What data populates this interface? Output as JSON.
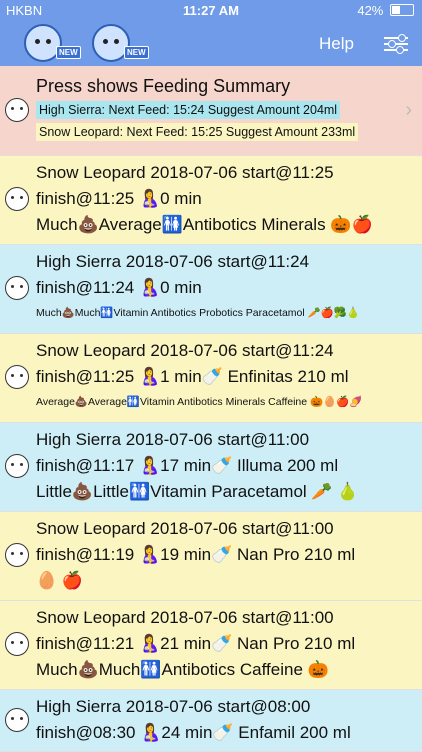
{
  "status": {
    "carrier": "HKBN",
    "time": "11:27 AM",
    "battery": "42%"
  },
  "nav": {
    "help_label": "Help",
    "new_badge": "NEW"
  },
  "summary": {
    "title": "Press shows Feeding Summary",
    "line1": "High Sierra:  Next Feed: 15:24 Suggest Amount 204ml",
    "line2": "Snow Leopard:  Next Feed: 15:25 Suggest Amount 233ml"
  },
  "rows": [
    {
      "color": "yellow",
      "l1": "Snow Leopard 2018-07-06 start@11:25",
      "l2": "finish@11:25 🤱0 min",
      "l3": "Much💩Average🚻Antibotics Minerals  🎃🍎",
      "l3_size": "large"
    },
    {
      "color": "blue",
      "l1": "High Sierra 2018-07-06 start@11:24",
      "l2": "finish@11:24  🤱0 min",
      "l3": "Much💩Much🚻Vitamin Antibotics Probotics Paracetamol  🥕🍎🥦🍐",
      "l3_size": "small"
    },
    {
      "color": "yellow",
      "l1": "Snow Leopard 2018-07-06 start@11:24",
      "l2": "finish@11:25  🤱1 min🍼 Enfinitas 210 ml",
      "l3": "Average💩Average🚻Vitamin Antibotics Minerals Caffeine  🎃🥚🍎🍠",
      "l3_size": "small"
    },
    {
      "color": "blue",
      "l1": "High Sierra 2018-07-06 start@11:00",
      "l2": "finish@11:17  🤱17 min🍼 Illuma 200 ml",
      "l3": "Little💩Little🚻Vitamin Paracetamol  🥕 🍐",
      "l3_size": "large"
    },
    {
      "color": "yellow",
      "l1": "Snow Leopard 2018-07-06 start@11:00",
      "l2": "finish@11:19  🤱19 min🍼 Nan Pro 210 ml",
      "l3": "   🥚 🍎",
      "l3_size": "large"
    },
    {
      "color": "yellow",
      "l1": "Snow Leopard 2018-07-06 start@11:00",
      "l2": "finish@11:21  🤱21 min🍼 Nan Pro 210 ml",
      "l3": "Much💩Much🚻Antibotics Caffeine  🎃",
      "l3_size": "large"
    },
    {
      "color": "blue",
      "l1": "High Sierra 2018-07-06 start@08:00",
      "l2": "finish@08:30  🤱24 min🍼 Enfamil 200 ml",
      "l3": "",
      "l3_size": "large"
    }
  ]
}
